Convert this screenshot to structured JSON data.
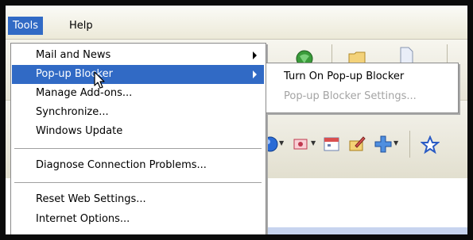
{
  "menubar": {
    "items": [
      {
        "label": "Tools",
        "active": true
      },
      {
        "label": "Help",
        "active": false
      }
    ]
  },
  "tools_menu": {
    "items": [
      {
        "label": "Mail and News",
        "submenu": true,
        "highlighted": false
      },
      {
        "label": "Pop-up Blocker",
        "submenu": true,
        "highlighted": true
      },
      {
        "label": "Manage Add-ons...",
        "submenu": false,
        "highlighted": false
      },
      {
        "label": "Synchronize...",
        "submenu": false,
        "highlighted": false
      },
      {
        "label": "Windows Update",
        "submenu": false,
        "highlighted": false
      },
      {
        "label": "Diagnose Connection Problems...",
        "submenu": false,
        "highlighted": false
      },
      {
        "label": "Reset Web Settings...",
        "submenu": false,
        "highlighted": false
      },
      {
        "label": "Internet Options...",
        "submenu": false,
        "highlighted": false
      }
    ]
  },
  "popup_submenu": {
    "items": [
      {
        "label": "Turn On Pop-up Blocker",
        "enabled": true
      },
      {
        "label": "Pop-up Blocker Settings...",
        "enabled": false
      }
    ]
  },
  "toolbar_icons": [
    "green-globe-icon",
    "folder-icon",
    "document-icon",
    "blue-orb-icon",
    "stamp-icon",
    "calendar-icon",
    "edit-icon",
    "add-icon",
    "star-icon"
  ],
  "colors": {
    "selection": "#316ac5",
    "menu_bg": "#ffffff",
    "chrome": "#ece9d8",
    "disabled_text": "#a4a4a4",
    "frame": "#0b0b0b"
  }
}
